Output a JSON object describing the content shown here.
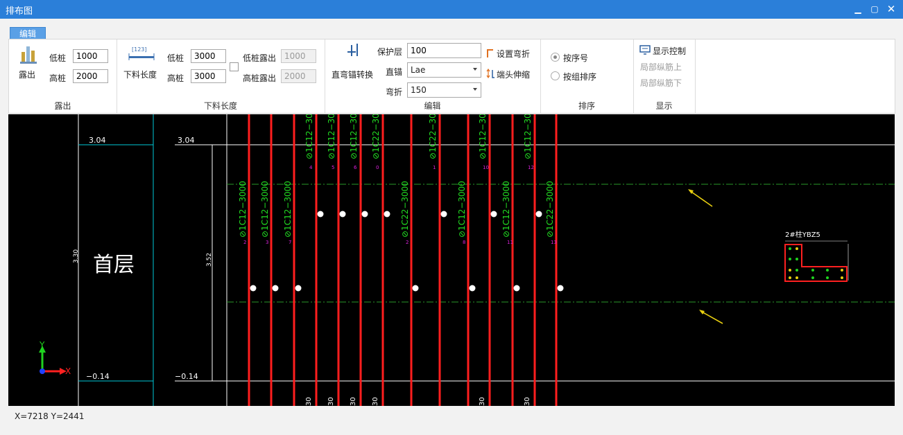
{
  "window": {
    "title": "排布图"
  },
  "ribbon": {
    "tab": "编辑",
    "groups": {
      "expose": {
        "label": "露出",
        "button": "露出",
        "low_label": "低桩",
        "low_value": "1000",
        "high_label": "高桩",
        "high_value": "2000"
      },
      "cut_length": {
        "label": "下料长度",
        "button": "下料长度",
        "button_icon_text": "[123]",
        "low_label": "低桩",
        "low_value": "3000",
        "high_label": "高桩",
        "high_value": "3000",
        "low_expose_label": "低桩露出",
        "low_expose_value": "1000",
        "high_expose_label": "高桩露出",
        "high_expose_value": "2000"
      },
      "edit": {
        "label": "编辑",
        "button": "直弯锚转换",
        "cover_label": "保护层",
        "cover_value": "100",
        "anchor_label": "直锚",
        "anchor_value": "Lae",
        "bend_label": "弯折",
        "bend_value": "150",
        "set_bend": "设置弯折",
        "end_stretch": "端头伸缩"
      },
      "sort": {
        "label": "排序",
        "by_number": "按序号",
        "by_group": "按组排序"
      },
      "display": {
        "label": "显示",
        "control": "显示控制",
        "local_up": "局部纵筋上",
        "local_down": "局部纵筋下"
      }
    }
  },
  "drawing": {
    "floor_label": "首层",
    "levels": {
      "top": "3.04",
      "bottom": "−0.14",
      "height": "3.52",
      "left_height": "3.30"
    },
    "axis": {
      "x": "X",
      "y": "Y"
    },
    "upper_rebars": [
      {
        "text": "1C12−30",
        "num": "4"
      },
      {
        "text": "1C12−30",
        "num": "5"
      },
      {
        "text": "1C12−30",
        "num": "6"
      },
      {
        "text": "1C22−30",
        "num": "0"
      },
      {
        "text": "1C22−30",
        "num": "1"
      },
      {
        "text": "1C12−30",
        "num": "10"
      },
      {
        "text": "1C12−30",
        "num": "12"
      }
    ],
    "lower_rebars": [
      {
        "text": "1C12−3000",
        "num": "2"
      },
      {
        "text": "1C12−3000",
        "num": "3"
      },
      {
        "text": "1C12−3000",
        "num": "7"
      },
      {
        "text": "1C22−3000",
        "num": "2"
      },
      {
        "text": "1C12−3000",
        "num": "8"
      },
      {
        "text": "1C12−3000",
        "num": "11"
      },
      {
        "text": "1C22−3000",
        "num": "13"
      }
    ],
    "bottom_labels": [
      "30",
      "30",
      "30",
      "30",
      "30",
      "30"
    ],
    "section_label": "2#柱YBZ5"
  },
  "status": {
    "coords": "X=7218 Y=2441"
  },
  "colors": {
    "titlebar": "#2b7fd9",
    "rebar": "#ff1e1e",
    "rebar_text": "#22dd22",
    "number_text": "#dd22dd",
    "cyan_line": "#00c8d8",
    "dashdot": "#2a9a2a",
    "arrow": "#e8cf10"
  }
}
